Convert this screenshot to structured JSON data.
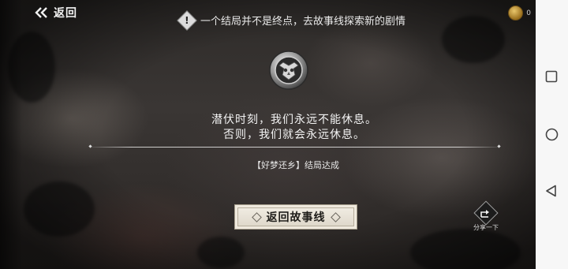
{
  "header": {
    "back_label": "返回",
    "hint_text": "一个结局并不是终点，去故事线探索新的剧情",
    "coin_count": "0"
  },
  "emblem": {
    "icon": "owl-crest-icon"
  },
  "quote": {
    "line1": "潜伏时刻，我们永远不能休息。",
    "line2": "否则，我们就会永远休息。"
  },
  "ending": {
    "text": "【好梦还乡】结局达成"
  },
  "actions": {
    "return_label": "返回故事线",
    "share_label": "分享一下"
  },
  "system_nav": {
    "buttons": [
      "recents-square-icon",
      "home-circle-icon",
      "back-triangle-icon"
    ]
  },
  "colors": {
    "button_bg": "#e9e4d9",
    "coin": "#d6a94a",
    "nav_bar": "#f7f7f7"
  }
}
